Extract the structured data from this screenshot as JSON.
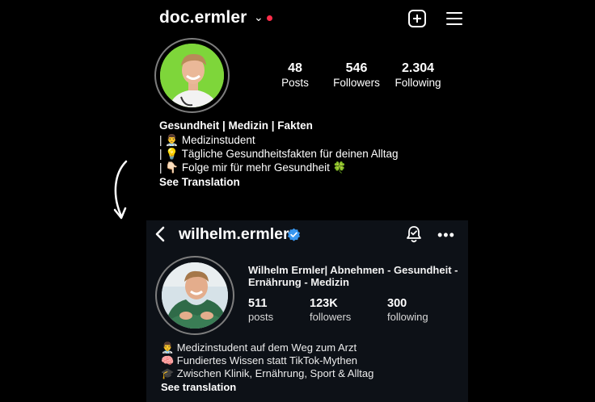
{
  "top_profile": {
    "username": "doc.ermler",
    "stats": [
      {
        "value": "48",
        "label": "Posts"
      },
      {
        "value": "546",
        "label": "Followers"
      },
      {
        "value": "2.304",
        "label": "Following"
      }
    ],
    "bio_title": "Gesundheit | Medizin | Fakten",
    "bio_lines": [
      "| 👨‍⚕️ Medizinstudent",
      "| 💡 Tägliche Gesundheitsfakten für deinen Alltag",
      "| 👇🏻 Folge mir für mehr Gesundheit 🍀"
    ],
    "see_translation": "See Translation",
    "notification_color": "#ff2d4a"
  },
  "bottom_profile": {
    "username": "wilhelm.ermler",
    "name_lines": [
      "Wilhelm Ermler| Abnehmen - Gesundheit -",
      "Ernährung - Medizin"
    ],
    "stats": [
      {
        "value": "511",
        "label": "posts"
      },
      {
        "value": "123K",
        "label": "followers"
      },
      {
        "value": "300",
        "label": "following"
      }
    ],
    "bio_lines": [
      "👨‍⚕️ Medizinstudent auf dem Weg zum Arzt",
      "🧠 Fundiertes Wissen statt TikTok-Mythen",
      "🎓 Zwischen Klinik, Ernährung, Sport & Alltag"
    ],
    "see_translation": "See translation",
    "verified_color": "#3897f0",
    "panel_color": "#0d1117"
  }
}
